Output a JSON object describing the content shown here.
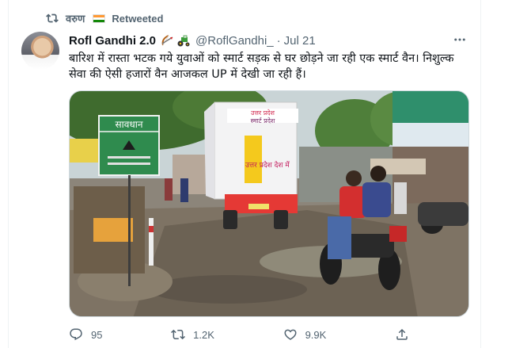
{
  "retweet": {
    "user": "वरुण",
    "label": "Retweeted",
    "flag_colors": [
      "#FF9933",
      "#FFFFFF",
      "#138808"
    ]
  },
  "tweet": {
    "author_name": "Rofl Gandhi 2.0",
    "author_emojis": [
      "bow-and-arrow-icon",
      "tractor-icon"
    ],
    "handle": "@RoflGandhi_",
    "separator": "·",
    "date": "Jul 21",
    "text": "बारिश में रास्ता भटक गये युवाओं को स्मार्ट सड़क से घर छोड़ने जा रही एक स्मार्ट वैन। निशुल्क सेवा की ऐसी हजारों वैन आजकल UP में देखी जा रही हैं।",
    "more_icon": "more-icon",
    "media": {
      "sign_title": "सावधान",
      "van_text_top": "उत्तर प्रदेश",
      "van_text_mid": "स्मार्ट प्रदेश",
      "van_text_side": "उत्तर प्रदेश देश में"
    }
  },
  "actions": {
    "reply_count": "95",
    "retweet_count": "1.2K",
    "like_count": "9.9K",
    "icons": [
      "reply-icon",
      "retweet-icon",
      "like-icon",
      "share-icon"
    ]
  },
  "colors": {
    "text_secondary": "#536471",
    "border": "#cfd9de"
  }
}
